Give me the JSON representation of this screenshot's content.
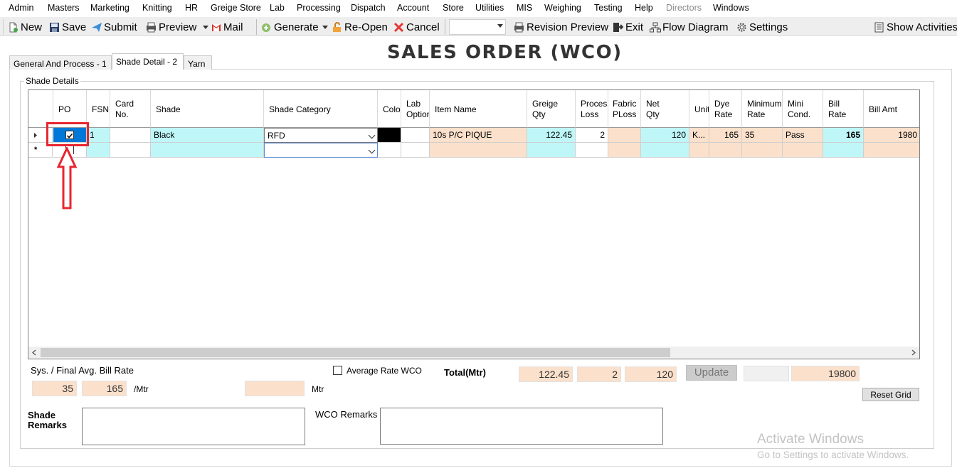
{
  "menu": [
    "Admin",
    "Masters",
    "Marketing",
    "Knitting",
    "HR",
    "Greige Store",
    "Lab",
    "Processing",
    "Dispatch",
    "Account",
    "Store",
    "Utilities",
    "MIS",
    "Weighing",
    "Testing",
    "Help",
    "Directors",
    "Windows"
  ],
  "toolbar": {
    "new": "New",
    "save": "Save",
    "submit": "Submit",
    "preview": "Preview",
    "mail": "Mail",
    "generate": "Generate",
    "reopen": "Re-Open",
    "cancel": "Cancel",
    "revision_preview": "Revision Preview",
    "exit": "Exit",
    "flow_diagram": "Flow Diagram",
    "settings": "Settings",
    "show_activities": "Show Activities"
  },
  "title": "SALES ORDER (WCO)",
  "tabs": [
    "General And Process - 1",
    "Shade Detail - 2",
    "Yarn"
  ],
  "active_tab": 1,
  "group_label": "Shade Details",
  "grid": {
    "headers": [
      "PO",
      "FSN",
      "Card\nNo.",
      "Shade",
      "Shade Category",
      "Color",
      "Lab\nOption",
      "Item Name",
      "Greige\nQty",
      "Process\nLoss",
      "Fabric\nPLoss",
      "Net\nQty",
      "Unit",
      "Dye\nRate",
      "Minimum\nRate",
      "Mini\nCond.",
      "Bill\nRate",
      "Bill Amt"
    ],
    "row": {
      "po_checked": true,
      "fsn": "1",
      "card_no": "",
      "shade": "Black",
      "shade_category": "RFD",
      "color": "#000000",
      "lab_option": "",
      "item_name": "10s P/C PIQUE",
      "greige_qty": "122.45",
      "process_loss": "2",
      "fabric_ploss": "",
      "net_qty": "120",
      "unit": "K...",
      "dye_rate": "165",
      "minimum_rate": "35",
      "mini_cond": "Pass",
      "bill_rate": "165",
      "bill_amt": "1980"
    },
    "new_row_marker": "*"
  },
  "form": {
    "avg_bill_rate_label": "Sys. / Final Avg. Bill Rate",
    "sys_rate": "35",
    "final_rate": "165",
    "per_unit": "/Mtr",
    "mtr_label": "Mtr",
    "mtr_value": "",
    "average_rate_wco_label": "Average Rate WCO",
    "average_rate_wco_checked": false,
    "total_label": "Total(Mtr)",
    "total_greige": "122.45",
    "total_process_loss": "2",
    "total_net": "120",
    "update_label": "Update",
    "total_blank": "",
    "total_amount": "19800",
    "reset_grid_label": "Reset Grid",
    "shade_remarks_label": "Shade\nRemarks",
    "wco_remarks_label": "WCO Remarks"
  },
  "watermark": {
    "line1": "Activate Windows",
    "line2": "Go to Settings to activate Windows."
  },
  "colors": {
    "cyan": "#bff7f9",
    "peach": "#fbe0cb",
    "selection": "#0078d7",
    "highlight": "#e8262f"
  }
}
